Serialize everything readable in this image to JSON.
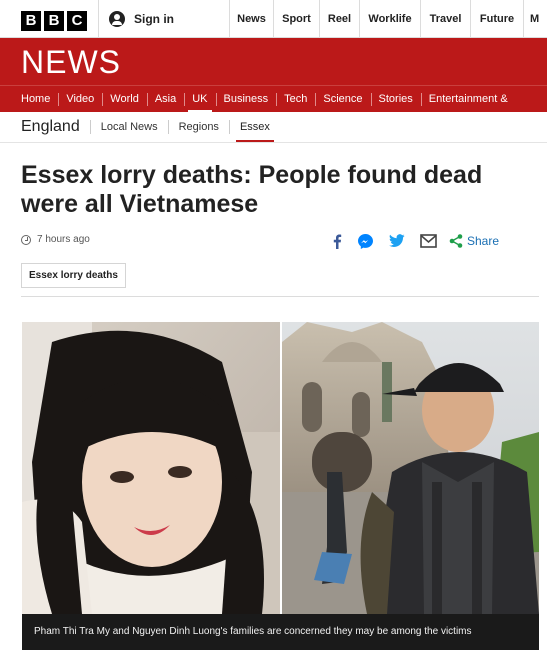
{
  "brand": {
    "letters": [
      "B",
      "B",
      "C"
    ],
    "section_name": "NEWS"
  },
  "account": {
    "sign_in_label": "Sign in"
  },
  "top_nav": [
    "News",
    "Sport",
    "Reel",
    "Worklife",
    "Travel",
    "Future",
    "M"
  ],
  "main_nav": [
    {
      "label": "Home",
      "active": false
    },
    {
      "label": "Video",
      "active": false
    },
    {
      "label": "World",
      "active": false
    },
    {
      "label": "Asia",
      "active": false
    },
    {
      "label": "UK",
      "active": true
    },
    {
      "label": "Business",
      "active": false
    },
    {
      "label": "Tech",
      "active": false
    },
    {
      "label": "Science",
      "active": false
    },
    {
      "label": "Stories",
      "active": false
    },
    {
      "label": "Entertainment &",
      "active": false
    }
  ],
  "sub_nav": {
    "region": "England",
    "items": [
      {
        "label": "Local News",
        "active": false
      },
      {
        "label": "Regions",
        "active": false
      },
      {
        "label": "Essex",
        "active": true
      }
    ]
  },
  "article": {
    "headline": "Essex lorry deaths: People found dead were all Vietnamese",
    "timestamp": "7 hours ago",
    "share_label": "Share",
    "tag": "Essex lorry deaths",
    "caption": "Pham Thi Tra My and Nguyen Dinh Luong's families are concerned they may be among the victims"
  },
  "share_icons": [
    "facebook-icon",
    "messenger-icon",
    "twitter-icon",
    "email-icon",
    "share-icon"
  ],
  "colors": {
    "brand_red": "#bb1919",
    "link_blue": "#1a6fb3",
    "facebook_blue": "#3b5998",
    "messenger_blue": "#0084ff",
    "twitter_blue": "#1da1f2"
  }
}
